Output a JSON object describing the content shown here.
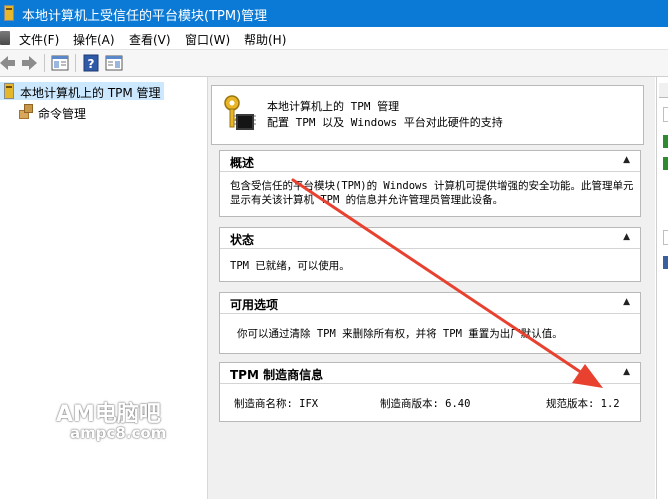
{
  "window": {
    "title": "本地计算机上受信任的平台模块(TPM)管理"
  },
  "menu": {
    "items": [
      {
        "label": "文件(F)"
      },
      {
        "label": "操作(A)"
      },
      {
        "label": "查看(V)"
      },
      {
        "label": "窗口(W)"
      },
      {
        "label": "帮助(H)"
      }
    ]
  },
  "toolbar": {
    "icons": [
      "back-arrow-icon",
      "forward-arrow-icon",
      "show-hide-tree-icon",
      "help-icon",
      "action-pane-icon"
    ]
  },
  "tree": {
    "root_label": "本地计算机上的 TPM 管理",
    "child_label": "命令管理"
  },
  "header": {
    "line1": "本地计算机上的 TPM 管理",
    "line2": "配置 TPM 以及 Windows 平台对此硬件的支持"
  },
  "sections": {
    "overview": {
      "title": "概述",
      "text": "包含受信任的平台模块(TPM)的 Windows 计算机可提供增强的安全功能。此管理单元显示有关该计算机 TPM 的信息并允许管理员管理此设备。"
    },
    "status": {
      "title": "状态",
      "text": "TPM 已就绪，可以使用。"
    },
    "options": {
      "title": "可用选项",
      "text": "你可以通过清除 TPM 来删除所有权，并将 TPM 重置为出厂默认值。"
    },
    "manufacturer": {
      "title": "TPM 制造商信息",
      "name_label": "制造商名称: IFX",
      "version_label": "制造商版本: 6.40",
      "spec_label": "规范版本: 1.2"
    }
  },
  "watermark": {
    "line1": "AM电脑吧",
    "line2": "ampc8.com"
  },
  "colors": {
    "titlebar": "#0a7ad6",
    "selection": "#cce8ff",
    "arrow": "#e8412f",
    "content_bg": "#f0f0f0"
  }
}
